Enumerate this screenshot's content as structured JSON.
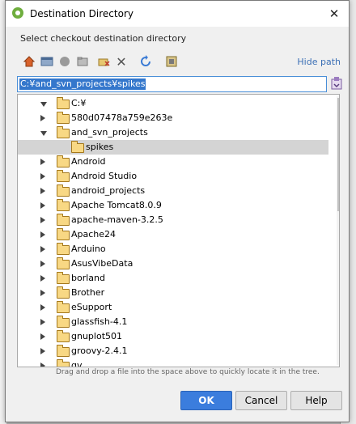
{
  "window": {
    "title": "Destination Directory",
    "close_glyph": "✕"
  },
  "subtitle": "Select checkout destination directory",
  "toolbar": {
    "hide_path_label": "Hide path",
    "icons": [
      "home-icon",
      "desktop-icon",
      "project-icon",
      "module-icon",
      "new-folder-icon",
      "delete-icon",
      "refresh-icon",
      "show-hidden-icon"
    ]
  },
  "path_field": {
    "value": "C:¥and_svn_projects¥spikes"
  },
  "tree": {
    "items": [
      {
        "label": "C:¥",
        "expanded": true
      },
      {
        "label": "580d07478a759e263e",
        "expanded": false
      },
      {
        "label": "and_svn_projects",
        "expanded": true
      },
      {
        "label": "spikes",
        "selected": true
      },
      {
        "label": "Android",
        "expanded": false
      },
      {
        "label": "Android Studio",
        "expanded": false
      },
      {
        "label": "android_projects",
        "expanded": false
      },
      {
        "label": "Apache Tomcat8.0.9",
        "expanded": false
      },
      {
        "label": "apache-maven-3.2.5",
        "expanded": false
      },
      {
        "label": "Apache24",
        "expanded": false
      },
      {
        "label": "Arduino",
        "expanded": false
      },
      {
        "label": "AsusVibeData",
        "expanded": false
      },
      {
        "label": "borland",
        "expanded": false
      },
      {
        "label": "Brother",
        "expanded": false
      },
      {
        "label": "eSupport",
        "expanded": false
      },
      {
        "label": "glassfish-4.1",
        "expanded": false
      },
      {
        "label": "gnuplot501",
        "expanded": false
      },
      {
        "label": "groovy-2.4.1",
        "expanded": false
      },
      {
        "label": "gv",
        "expanded": false
      }
    ]
  },
  "hint": "Drag and drop a file into the space above to quickly locate it in the tree.",
  "buttons": {
    "ok": "OK",
    "cancel": "Cancel",
    "help": "Help"
  },
  "colors": {
    "accent": "#3b7ddd",
    "selection": "#3477cc",
    "folder": "#f8d884",
    "link": "#3b6fb5"
  }
}
